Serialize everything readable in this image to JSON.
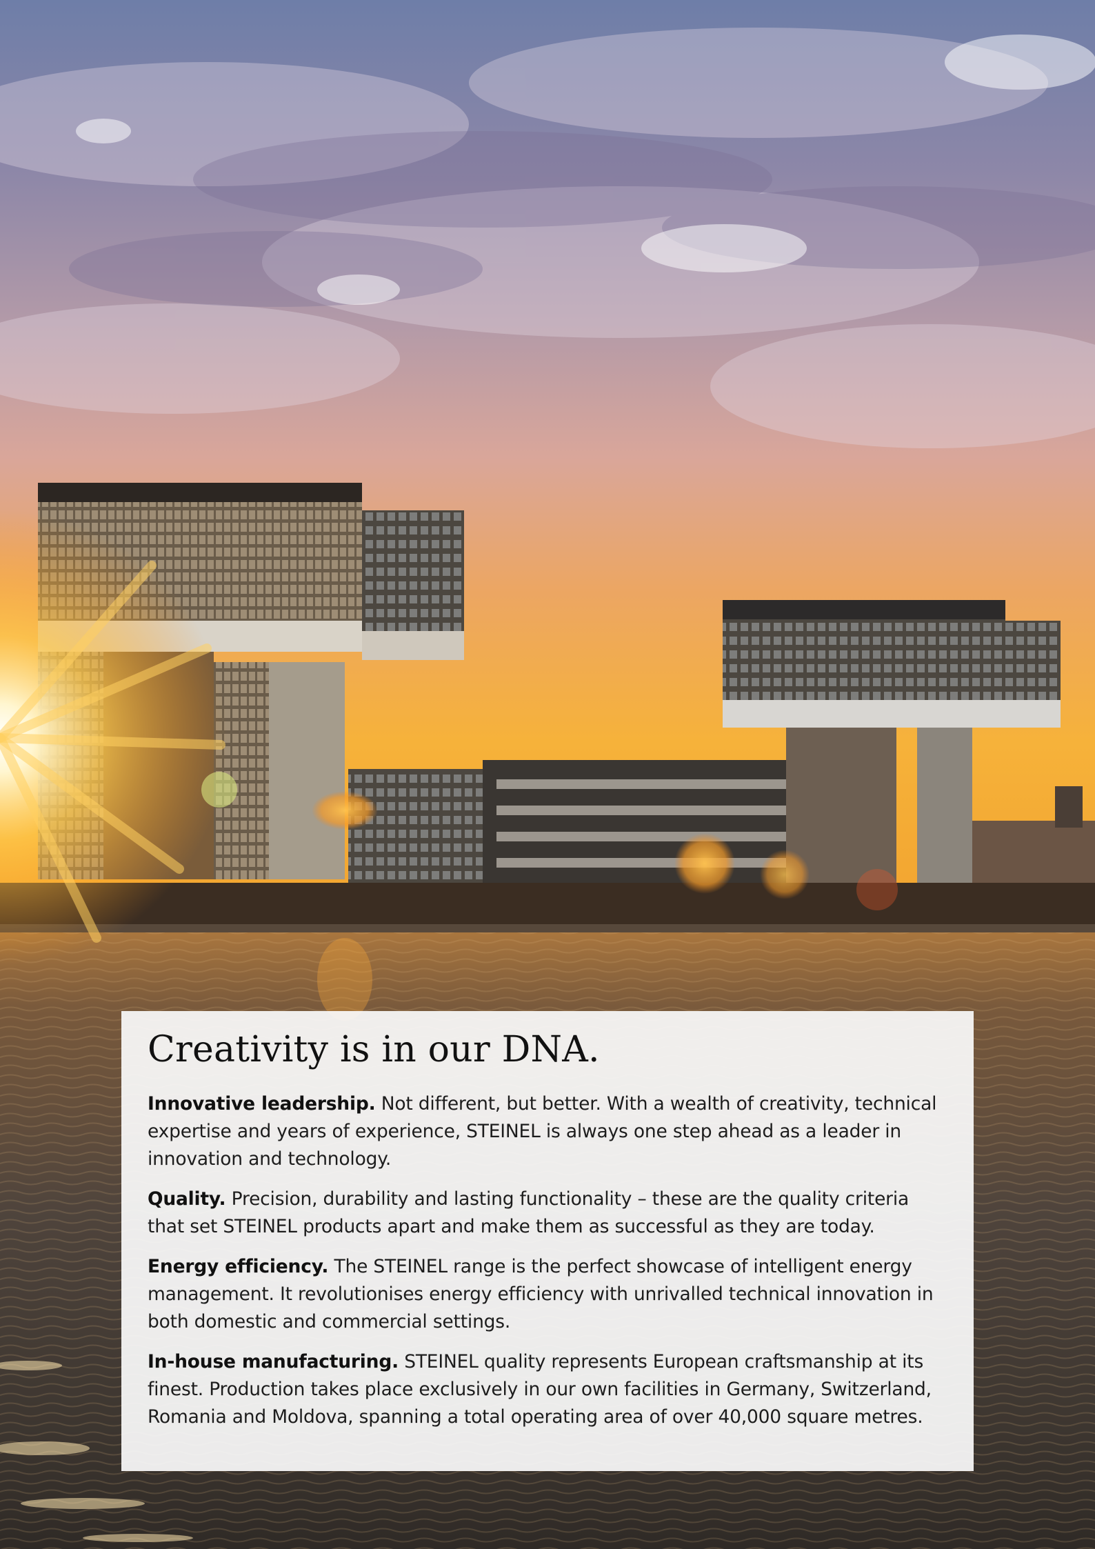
{
  "document": {
    "headline": "Creativity is in our DNA.",
    "paragraphs": [
      {
        "lead": "Innovative leadership.",
        "text": "Not different, but better. With a wealth of creativity, technical expertise and years of experience, STEINEL is always one step ahead as a leader in innovation and technology."
      },
      {
        "lead": "Quality.",
        "text": "Precision, durability and lasting functionality – these are the quality criteria that set STEINEL products apart and make them as successful as they are today."
      },
      {
        "lead": "Energy efficiency.",
        "text": "The STEINEL range is the perfect showcase of intelligent energy management. It revolutionises energy efficiency with unrivalled technical innovation in both domestic and commercial settings."
      },
      {
        "lead": "In-house manufacturing.",
        "text": "STEINEL quality represents European craftsmanship at its finest. Production takes place exclusively in our own facilities in Germany, Switzerland, Romania and Moldova, spanning a total operating area of over 40,000 square metres."
      }
    ]
  },
  "colors": {
    "panel_background": "#fafafa",
    "text": "#1d1d1d",
    "sky_top": "#6f7fa6",
    "sunset_glow": "#f4a73a",
    "water": "#4a3c30"
  }
}
